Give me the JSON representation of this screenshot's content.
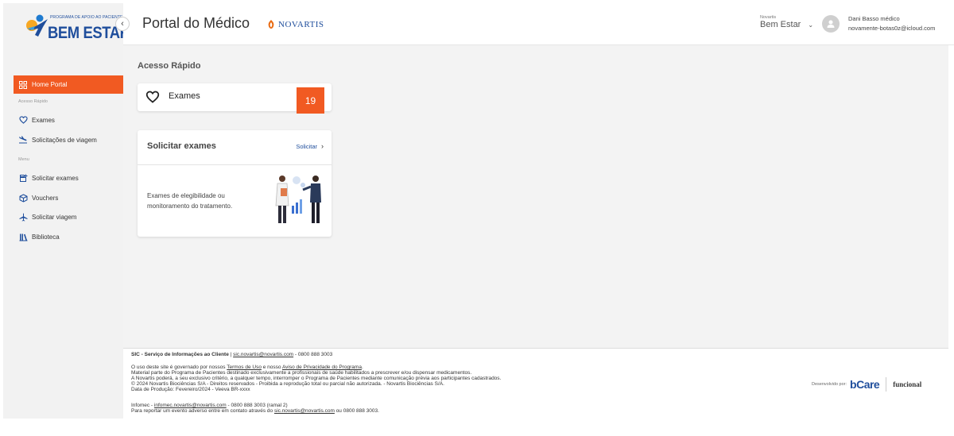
{
  "logo": {
    "tagline": "PROGRAMA DE APOIO AO PACIENTE",
    "brand": "BEM ESTAR"
  },
  "header": {
    "title": "Portal do Médico",
    "partner": "NOVARTIS",
    "program_label": "Novartis",
    "program_value": "Bem Estar",
    "user_name": "Dani Basso médico",
    "user_email": "novamente-botas0z@icloud.com"
  },
  "sidebar": {
    "home": "Home Portal",
    "quick_access_label": "Acesso Rápido",
    "quick_items": [
      {
        "label": "Exames",
        "icon": "heart-icon"
      },
      {
        "label": "Solicitações de viagem",
        "icon": "flight-land-icon"
      }
    ],
    "menu_label": "Menu",
    "menu_items": [
      {
        "label": "Solicitar exames",
        "icon": "add-document-icon"
      },
      {
        "label": "Vouchers",
        "icon": "box-icon"
      },
      {
        "label": "Solicitar viagem",
        "icon": "airplane-icon"
      },
      {
        "label": "Biblioteca",
        "icon": "library-icon"
      }
    ]
  },
  "main": {
    "quick_access_title": "Acesso Rápido",
    "quick_card": {
      "label": "Exames",
      "count": "19"
    },
    "request_card": {
      "title": "Solicitar exames",
      "link": "Solicitar",
      "description": "Exames de elegibilidade ou monitoramento do tratamento."
    }
  },
  "footer": {
    "sic_title": "SIC - Serviço de Informações ao Cliente",
    "sic_sep": " | ",
    "sic_email": "sic.novartis@novartis.com",
    "sic_phone": " - 0800 888 3003",
    "legal_1a": "O uso deste site é governado por nossos ",
    "terms": "Termos de Uso",
    "legal_1b": " e nosso ",
    "privacy": "Aviso de Privacidade do Programa",
    "legal_1c": ".",
    "legal_2": "Material parte do Programa de Pacientes destinado exclusivamente a profissionais de saúde habilitados a prescrever e/ou dispensar medicamentos.",
    "legal_3": "A Novartis poderá, a seu exclusivo critério, a qualquer tempo, interromper o Programa de Pacientes mediante comunicação prévia aos participantes cadastrados.",
    "legal_4": "© 2024 Novartis Biociências S/A - Direitos reservados - Proibida a reprodução total ou parcial não autorizada. - Novartis Biociências S/A.",
    "legal_5": "Data de Produção: Fevereiro/2024 - Veeva BR-xxxx",
    "infomec_a": "Infomec - ",
    "infomec_email": "infomec.novartis@novartis.com",
    "infomec_b": " - 0800 888 3003 (ramal 2)",
    "adverse_a": "Para reportar um evento adverso entre em contato através do ",
    "adverse_email": "sic.novartis@novartis.com",
    "adverse_b": " ou 0800 888 3003.",
    "developed_by": "Desenvolvido por:",
    "dev_brand_1": "bCare",
    "dev_brand_2": "funcional"
  },
  "colors": {
    "accent": "#f15a22",
    "brand_blue": "#1f4e9c"
  }
}
